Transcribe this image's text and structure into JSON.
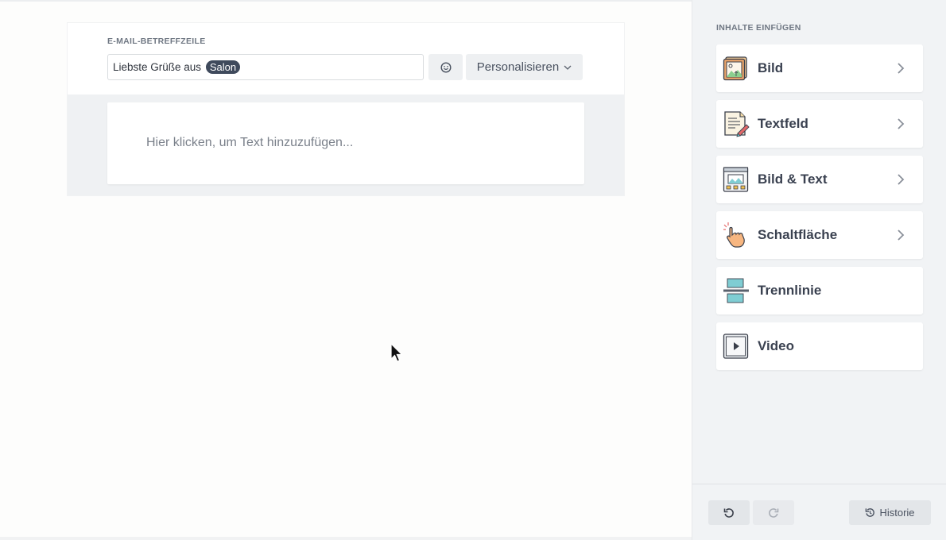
{
  "editor": {
    "subject_label": "E-MAIL-BETREFFZEILE",
    "subject_text": "Liebste Grüße aus ",
    "subject_tag": "Salon",
    "emoji_button_icon": "smiley-icon",
    "personalize_label": "Personalisieren",
    "text_placeholder": "Hier klicken, um Text hinzuzufügen..."
  },
  "sidebar": {
    "title": "INHALTE EINFÜGEN",
    "items": [
      {
        "label": "Bild",
        "icon": "image-icon",
        "has_chevron": true
      },
      {
        "label": "Textfeld",
        "icon": "text-document-icon",
        "has_chevron": true
      },
      {
        "label": "Bild & Text",
        "icon": "image-text-icon",
        "has_chevron": true
      },
      {
        "label": "Schaltfläche",
        "icon": "pointer-hand-icon",
        "has_chevron": true
      },
      {
        "label": "Trennlinie",
        "icon": "divider-icon",
        "has_chevron": false
      },
      {
        "label": "Video",
        "icon": "video-play-icon",
        "has_chevron": false
      }
    ],
    "footer": {
      "undo_icon": "undo-icon",
      "redo_icon": "redo-icon",
      "history_label": "Historie"
    }
  },
  "colors": {
    "tag_bg": "#3f4a5c",
    "sidebar_bg": "#f1f3f5",
    "accent_teal": "#5fc8cf"
  }
}
